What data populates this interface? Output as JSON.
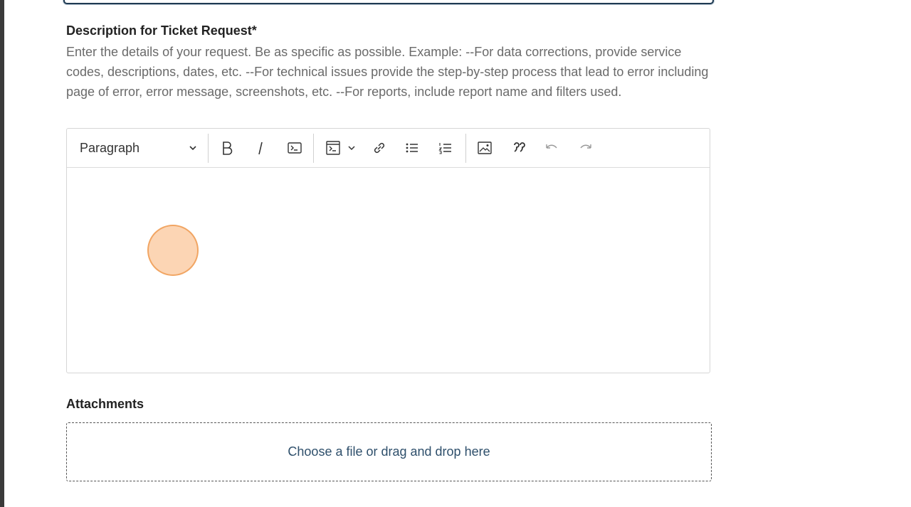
{
  "form": {
    "description_label": "Description for Ticket Request*",
    "description_help": "Enter the details of your request. Be as specific as possible. Example: --For data corrections, provide service codes, descriptions, dates, etc. --For technical issues provide the step-by-step process that lead to error including page of error, error message, screenshots, etc. --For reports, include report name and filters used.",
    "attachments_label": "Attachments",
    "dropzone_text": "Choose a file or drag and drop here"
  },
  "editor": {
    "block_format": "Paragraph",
    "content": ""
  },
  "colors": {
    "text": "#222222",
    "help_text": "#6a6a6a",
    "link_text": "#2e4f6b",
    "cursor_highlight": "#fabe8c"
  }
}
